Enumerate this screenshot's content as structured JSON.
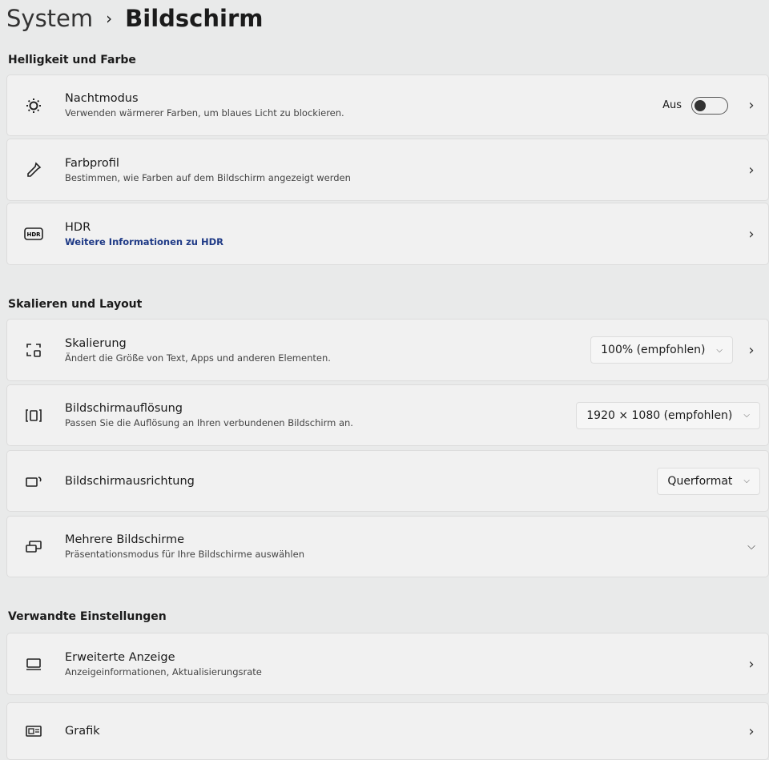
{
  "breadcrumb": {
    "parent": "System",
    "separator": "›",
    "current": "Bildschirm"
  },
  "sections": {
    "brightness": "Helligkeit und Farbe",
    "scale": "Skalieren und Layout",
    "related": "Verwandte Einstellungen"
  },
  "items": {
    "night": {
      "title": "Nachtmodus",
      "desc": "Verwenden wärmerer Farben, um blaues Licht zu blockieren.",
      "toggle_label": "Aus",
      "toggle_on": false,
      "icon": "brightness-icon"
    },
    "profile": {
      "title": "Farbprofil",
      "desc": "Bestimmen, wie Farben auf dem Bildschirm angezeigt werden",
      "icon": "eyedropper-icon"
    },
    "hdr": {
      "title": "HDR",
      "link": "Weitere Informationen zu HDR",
      "icon": "hdr-icon"
    },
    "scaling": {
      "title": "Skalierung",
      "desc": "Ändert die Größe von Text, Apps und anderen Elementen.",
      "value": "100% (empfohlen)"
    },
    "resolution": {
      "title": "Bildschirmauflösung",
      "desc": "Passen Sie die Auflösung an Ihren verbundenen Bildschirm an.",
      "value": "1920 × 1080 (empfohlen)"
    },
    "orientation": {
      "title": "Bildschirmausrichtung",
      "value": "Querformat"
    },
    "multi": {
      "title": "Mehrere Bildschirme",
      "desc": "Präsentationsmodus für Ihre Bildschirme auswählen"
    },
    "advanced": {
      "title": "Erweiterte Anzeige",
      "desc": "Anzeigeinformationen, Aktualisierungsrate"
    },
    "graphics": {
      "title": "Grafik"
    }
  }
}
